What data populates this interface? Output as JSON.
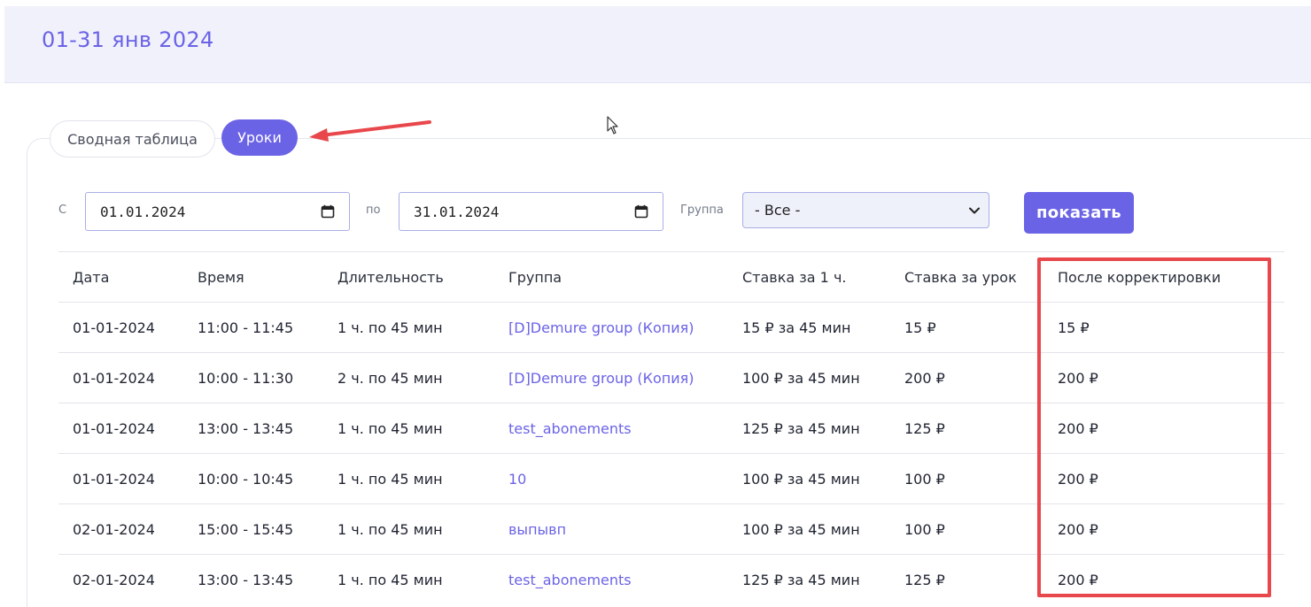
{
  "period": {
    "title": "01-31 янв 2024"
  },
  "tabs": [
    {
      "label": "Сводная таблица",
      "active": false
    },
    {
      "label": "Уроки",
      "active": true
    }
  ],
  "filters": {
    "from_label": "С",
    "from_value": "01.01.2024",
    "to_label": "по",
    "to_value": "31.01.2024",
    "group_label": "Группа",
    "group_value": "- Все -",
    "show_button": "показать"
  },
  "table": {
    "columns": [
      "Дата",
      "Время",
      "Длительность",
      "Группа",
      "Ставка за 1 ч.",
      "Ставка за урок",
      "После корректировки"
    ],
    "rows": [
      [
        "01-01-2024",
        "11:00 - 11:45",
        "1 ч. по 45 мин",
        "[D]Demure group (Копия)",
        "15 ₽ за 45 мин",
        "15 ₽",
        "15 ₽"
      ],
      [
        "01-01-2024",
        "10:00 - 11:30",
        "2 ч. по 45 мин",
        "[D]Demure group (Копия)",
        "100 ₽ за 45 мин",
        "200 ₽",
        "200 ₽"
      ],
      [
        "01-01-2024",
        "13:00 - 13:45",
        "1 ч. по 45 мин",
        "test_abonements",
        "125 ₽ за 45 мин",
        "125 ₽",
        "200 ₽"
      ],
      [
        "01-01-2024",
        "10:00 - 10:45",
        "1 ч. по 45 мин",
        "10",
        "100 ₽ за 45 мин",
        "100 ₽",
        "200 ₽"
      ],
      [
        "02-01-2024",
        "15:00 - 15:45",
        "1 ч. по 45 мин",
        "выпывп",
        "100 ₽ за 45 мин",
        "100 ₽",
        "200 ₽"
      ],
      [
        "02-01-2024",
        "13:00 - 13:45",
        "1 ч. по 45 мин",
        "test_abonements",
        "125 ₽ за 45 мин",
        "125 ₽",
        "200 ₽"
      ]
    ]
  },
  "colors": {
    "accent": "#6b63e6",
    "annotation": "#e8474b",
    "header_bg": "#f0f1fb"
  }
}
